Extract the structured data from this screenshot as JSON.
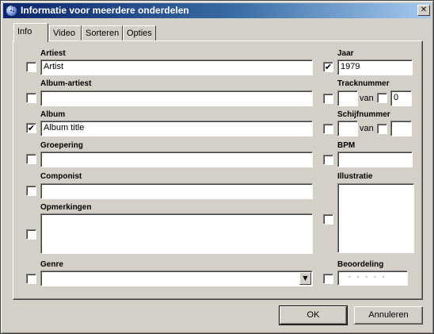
{
  "window": {
    "title": "Informatie voor meerdere onderdelen",
    "close_symbol": "✕"
  },
  "tabs": [
    {
      "label": "Info",
      "active": true
    },
    {
      "label": "Video",
      "active": false
    },
    {
      "label": "Sorteren",
      "active": false
    },
    {
      "label": "Opties",
      "active": false
    }
  ],
  "fields": {
    "artist": {
      "label": "Artiest",
      "value": "Artist",
      "checked": false
    },
    "album_artist": {
      "label": "Album-artiest",
      "value": "",
      "checked": false
    },
    "album": {
      "label": "Album",
      "value": "Album title",
      "checked": true
    },
    "grouping": {
      "label": "Groepering",
      "value": "",
      "checked": false
    },
    "composer": {
      "label": "Componist",
      "value": "",
      "checked": false
    },
    "comments": {
      "label": "Opmerkingen",
      "value": "",
      "checked": false
    },
    "genre": {
      "label": "Genre",
      "value": "",
      "checked": false
    },
    "year": {
      "label": "Jaar",
      "value": "1979",
      "checked": true
    },
    "track_number": {
      "label": "Tracknummer",
      "value": "",
      "of_label": "van",
      "of_value": "0",
      "checked": false
    },
    "disc_number": {
      "label": "Schijfnummer",
      "value": "",
      "of_label": "van",
      "of_value": "",
      "checked": false
    },
    "bpm": {
      "label": "BPM",
      "value": "",
      "checked": false
    },
    "artwork": {
      "label": "Illustratie",
      "checked": false
    },
    "rating": {
      "label": "Beoordeling",
      "stars": "•••••",
      "checked": false
    }
  },
  "check_mark": "✔",
  "buttons": {
    "ok": "OK",
    "cancel": "Annuleren"
  },
  "icons": {
    "title": "app-icon",
    "close": "close-icon",
    "combo": "chevron-down-icon"
  }
}
